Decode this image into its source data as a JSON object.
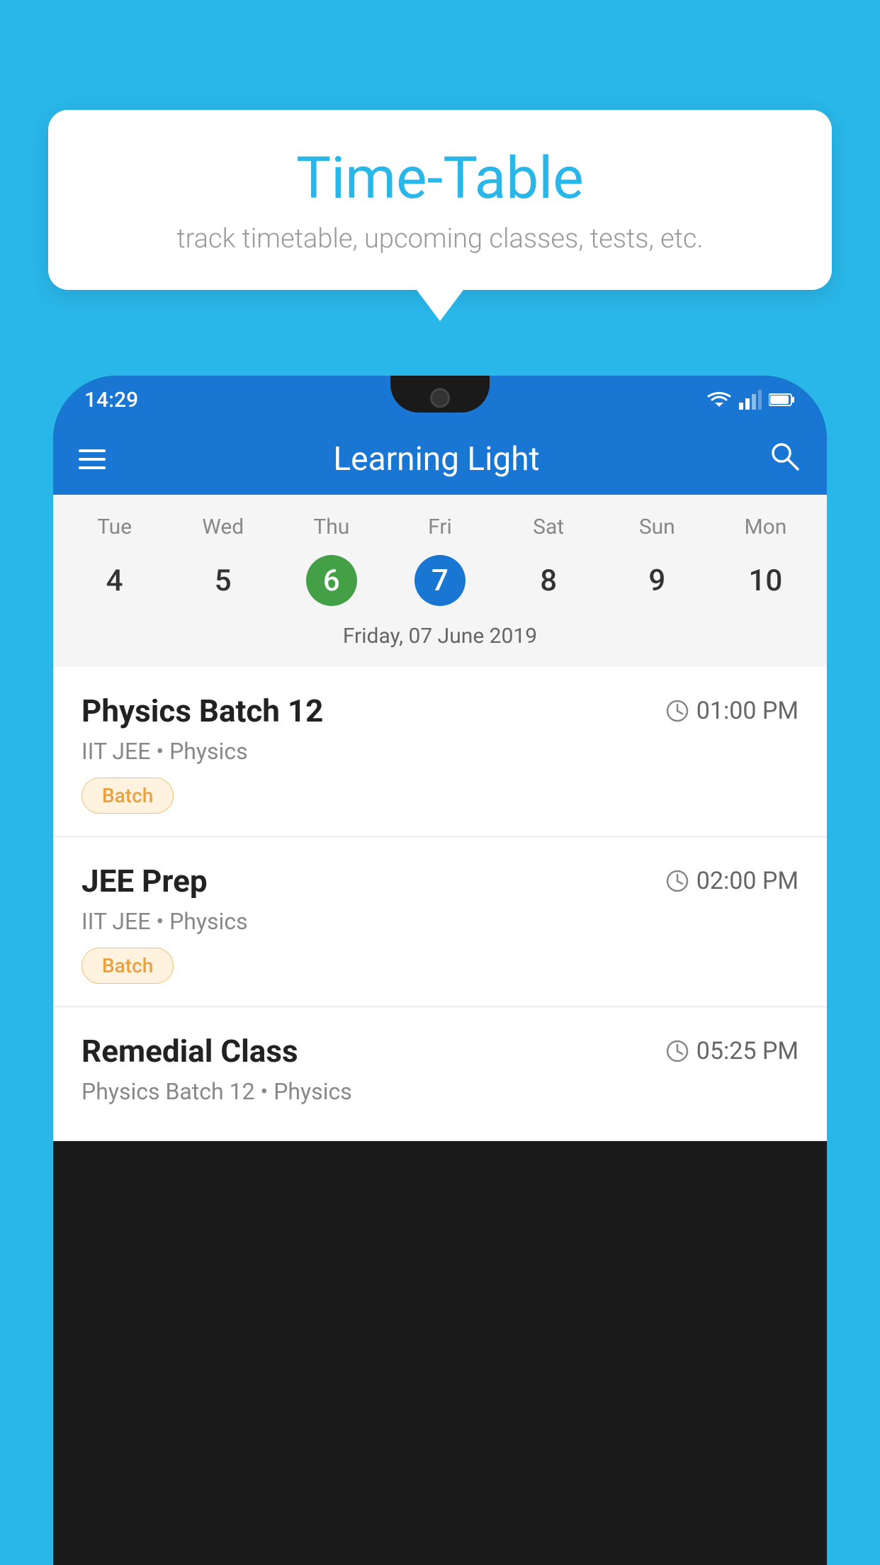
{
  "background_color": "#29B6E8",
  "tooltip": {
    "title": "Time-Table",
    "subtitle": "track timetable, upcoming classes, tests, etc."
  },
  "phone": {
    "status_bar": {
      "time": "14:29",
      "wifi_icon": "wifi",
      "signal_icon": "signal",
      "battery_icon": "battery"
    },
    "app_bar": {
      "menu_icon": "menu",
      "title": "Learning Light",
      "search_icon": "search"
    },
    "calendar": {
      "days": [
        "Tue",
        "Wed",
        "Thu",
        "Fri",
        "Sat",
        "Sun",
        "Mon"
      ],
      "dates": [
        {
          "num": "4",
          "state": "normal"
        },
        {
          "num": "5",
          "state": "normal"
        },
        {
          "num": "6",
          "state": "today"
        },
        {
          "num": "7",
          "state": "selected"
        },
        {
          "num": "8",
          "state": "normal"
        },
        {
          "num": "9",
          "state": "normal"
        },
        {
          "num": "10",
          "state": "normal"
        }
      ],
      "selected_date_label": "Friday, 07 June 2019"
    },
    "schedule": [
      {
        "title": "Physics Batch 12",
        "time": "01:00 PM",
        "subtitle": "IIT JEE • Physics",
        "badge": "Batch"
      },
      {
        "title": "JEE Prep",
        "time": "02:00 PM",
        "subtitle": "IIT JEE • Physics",
        "badge": "Batch"
      },
      {
        "title": "Remedial Class",
        "time": "05:25 PM",
        "subtitle": "Physics Batch 12 • Physics",
        "badge": ""
      }
    ]
  }
}
